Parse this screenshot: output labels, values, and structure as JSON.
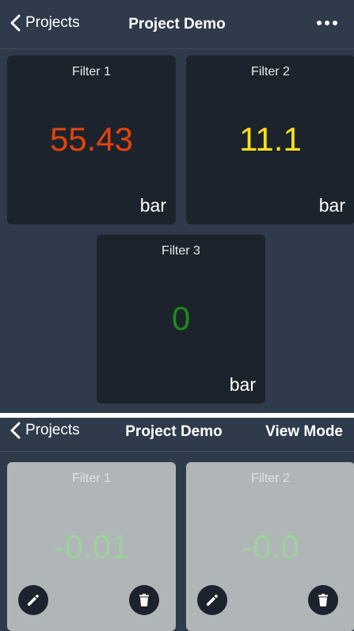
{
  "screen_top": {
    "back_label": "Projects",
    "title": "Project Demo",
    "more_icon": "ellipsis-icon",
    "cards": [
      {
        "title": "Filter 1",
        "value": "55.43",
        "unit": "bar",
        "value_color": "#e0440e"
      },
      {
        "title": "Filter 2",
        "value": "11.1",
        "unit": "bar",
        "value_color": "#ffe019"
      },
      {
        "title": "Filter 3",
        "value": "0",
        "unit": "bar",
        "value_color": "#1e8a1e"
      }
    ]
  },
  "screen_bottom": {
    "back_label": "Projects",
    "title": "Project Demo",
    "mode_label": "View Mode",
    "cards": [
      {
        "title": "Filter 1",
        "value": "-0.01",
        "value_color": "#9dd29d",
        "edit_icon": "pencil-icon",
        "delete_icon": "trash-icon"
      },
      {
        "title": "Filter 2",
        "value": "-0.0",
        "value_color": "#9dd29d",
        "edit_icon": "pencil-icon",
        "delete_icon": "trash-icon"
      }
    ]
  },
  "colors": {
    "background": "#2f3b4b",
    "card_dark": "#1d232c",
    "card_light": "#b0b6b8"
  }
}
